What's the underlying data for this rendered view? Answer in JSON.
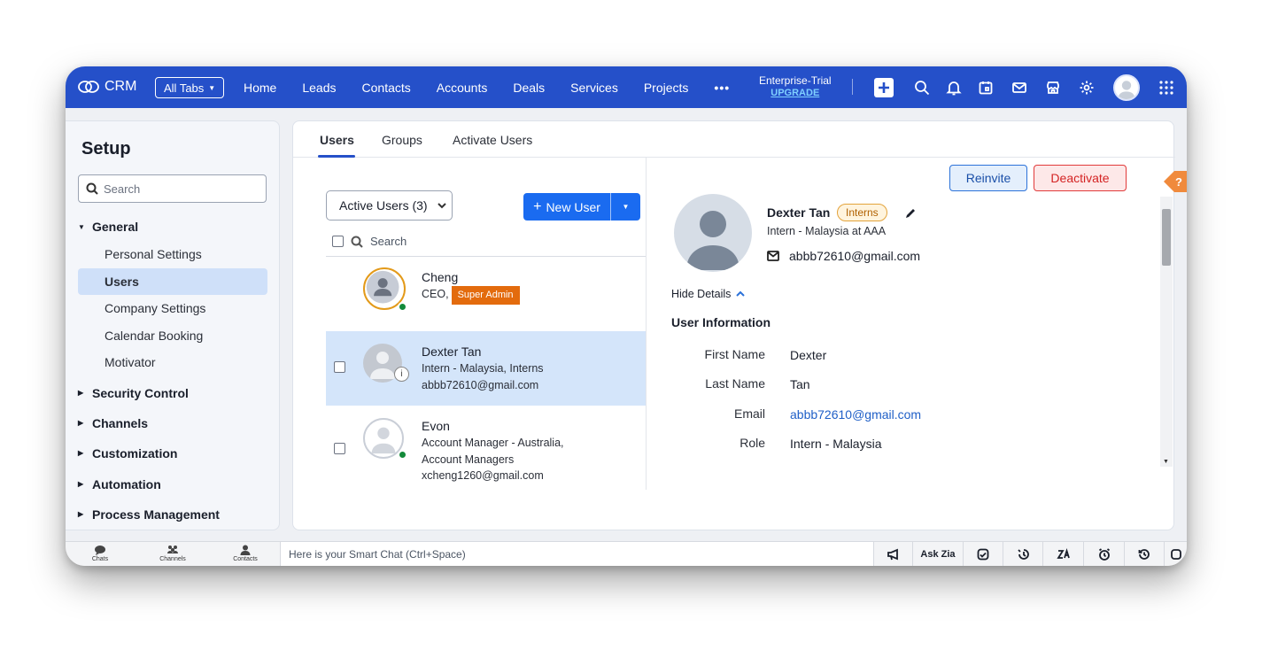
{
  "app": {
    "name": "CRM",
    "all_tabs": "All Tabs",
    "nav": [
      "Home",
      "Leads",
      "Contacts",
      "Accounts",
      "Deals",
      "Services",
      "Projects"
    ],
    "more": "•••",
    "plan": "Enterprise-Trial",
    "upgrade": "UPGRADE"
  },
  "sidebar": {
    "title": "Setup",
    "search_placeholder": "Search",
    "general": "General",
    "items": [
      "Personal Settings",
      "Users",
      "Company Settings",
      "Calendar Booking",
      "Motivator"
    ],
    "sections": [
      "Security Control",
      "Channels",
      "Customization",
      "Automation",
      "Process Management"
    ]
  },
  "tabs": [
    "Users",
    "Groups",
    "Activate Users"
  ],
  "list": {
    "filter": "Active Users (3)",
    "new_user": "New User",
    "search": "Search",
    "users": [
      {
        "name": "Cheng",
        "line1": "CEO,",
        "badge": "Super Admin"
      },
      {
        "name": "Dexter Tan",
        "line1": "Intern - Malaysia, Interns",
        "line2": "abbb72610@gmail.com"
      },
      {
        "name": "Evon",
        "line1": "Account Manager - Australia,",
        "line2": "Account Managers",
        "line3": "xcheng1260@gmail.com"
      }
    ]
  },
  "detail": {
    "reinvite": "Reinvite",
    "deactivate": "Deactivate",
    "name": "Dexter Tan",
    "badge": "Interns",
    "subtitle": "Intern - Malaysia  at  AAA",
    "email": "abbb72610@gmail.com",
    "hide_details": "Hide Details",
    "section_title": "User Information",
    "fields": [
      {
        "label": "First Name",
        "value": "Dexter"
      },
      {
        "label": "Last Name",
        "value": "Tan"
      },
      {
        "label": "Email",
        "value": "abbb72610@gmail.com"
      },
      {
        "label": "Role",
        "value": "Intern - Malaysia"
      }
    ]
  },
  "bottombar": {
    "chats": "Chats",
    "channels": "Channels",
    "contacts": "Contacts",
    "smart_chat": "Here is your Smart Chat (Ctrl+Space)",
    "ask_zia": "Ask Zia"
  },
  "colors": {
    "topbar": "#2550c9",
    "primary": "#1a6bf0",
    "selected_row": "#d4e5fa",
    "admin_badge": "#e36b0d"
  }
}
